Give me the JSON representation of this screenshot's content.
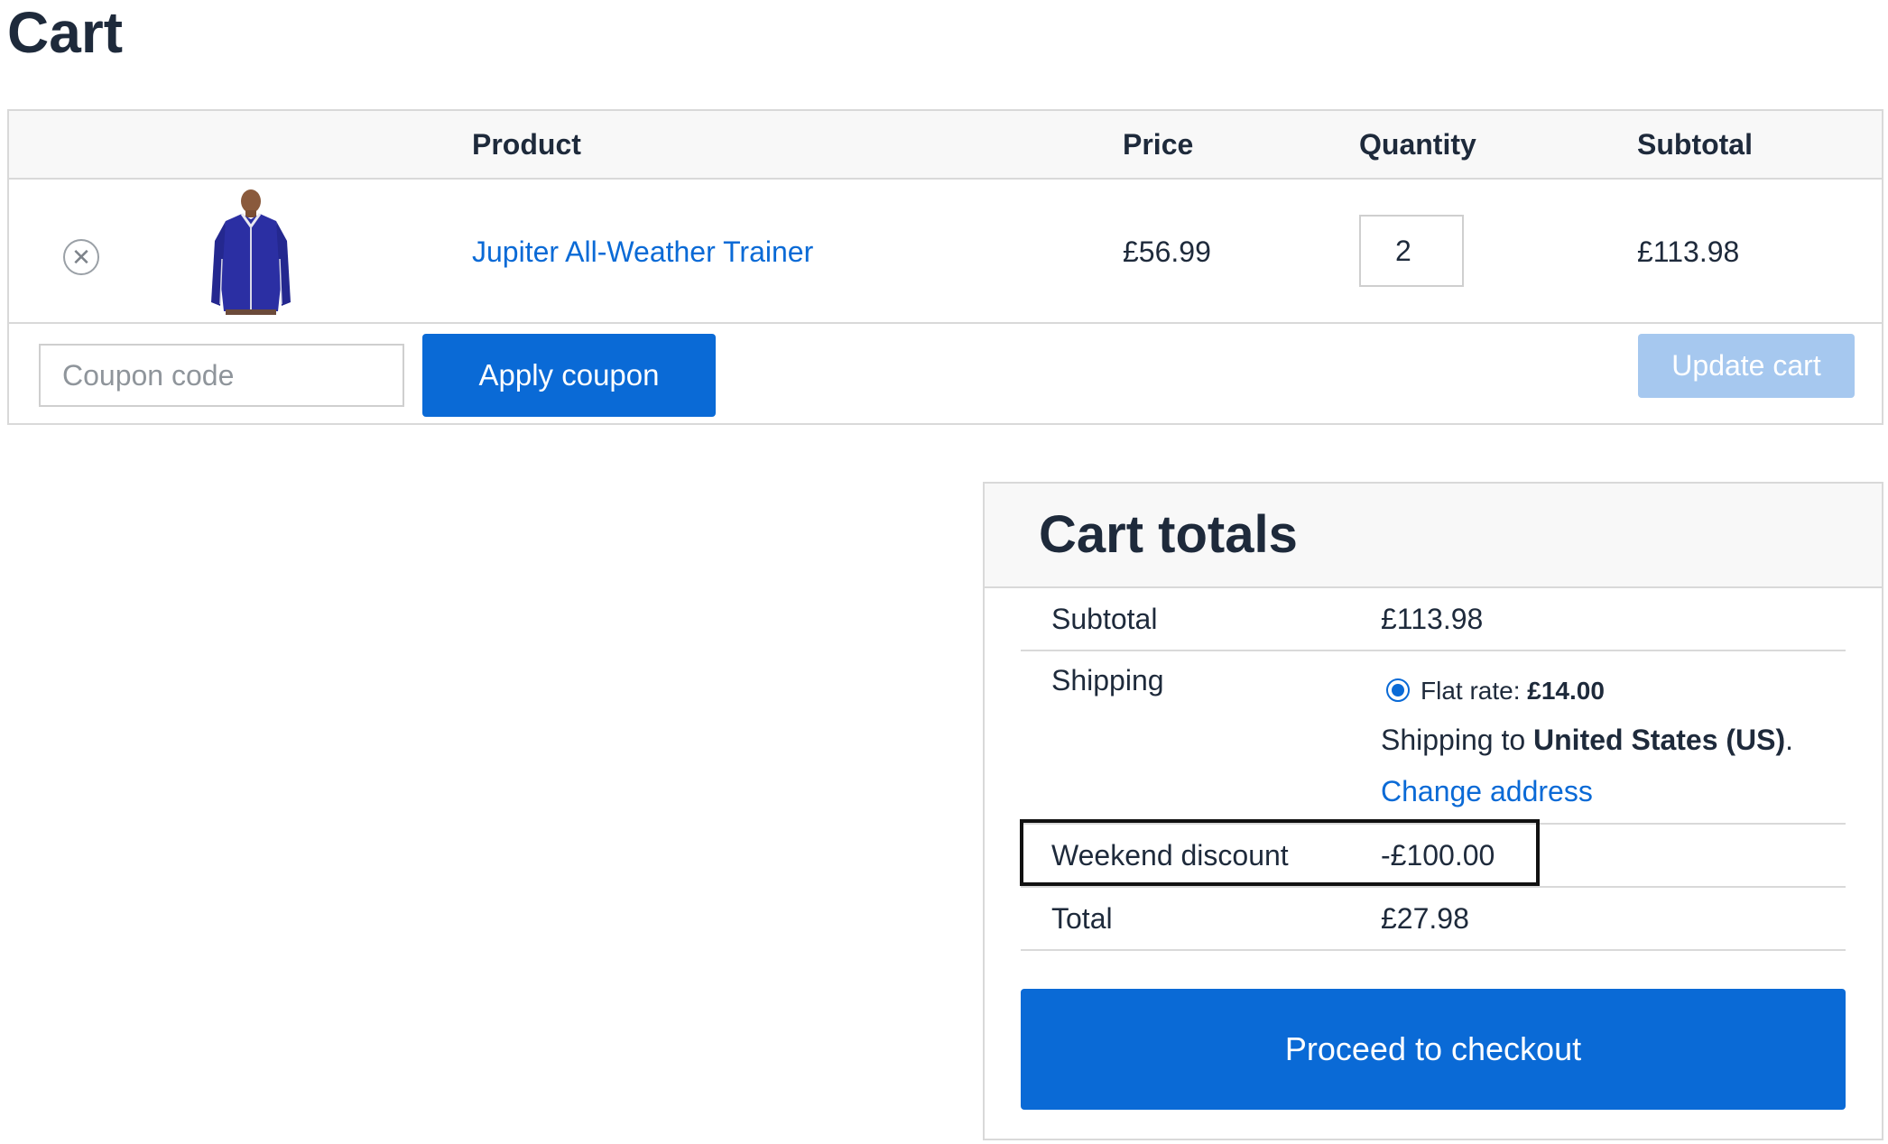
{
  "page": {
    "title": "Cart"
  },
  "cart_table": {
    "headers": {
      "product": "Product",
      "price": "Price",
      "quantity": "Quantity",
      "subtotal": "Subtotal"
    },
    "items": [
      {
        "remove_icon": "close-circle-icon",
        "image": "blue zip-up trainer jacket",
        "name": "Jupiter All-Weather Trainer",
        "price": "£56.99",
        "quantity": "2",
        "subtotal": "£113.98"
      }
    ],
    "coupon": {
      "placeholder": "Coupon code",
      "value": "",
      "apply_label": "Apply coupon"
    },
    "update_label": "Update cart"
  },
  "cart_totals": {
    "title": "Cart totals",
    "subtotal": {
      "label": "Subtotal",
      "value": "£113.98"
    },
    "shipping": {
      "label": "Shipping",
      "method_label": "Flat rate: ",
      "method_price": "£14.00",
      "destination_prefix": "Shipping to ",
      "destination": "United States (US)",
      "destination_suffix": ".",
      "change_address_label": "Change address"
    },
    "discount": {
      "label": "Weekend discount",
      "value": "-£100.00"
    },
    "total": {
      "label": "Total",
      "value": "£27.98"
    },
    "checkout_label": "Proceed to checkout"
  },
  "colors": {
    "accent": "#0a6ad6",
    "accent_disabled": "#a6c8ef",
    "text": "#1e2a3b",
    "border": "#d9d9d9",
    "header_bg": "#f8f8f8"
  }
}
